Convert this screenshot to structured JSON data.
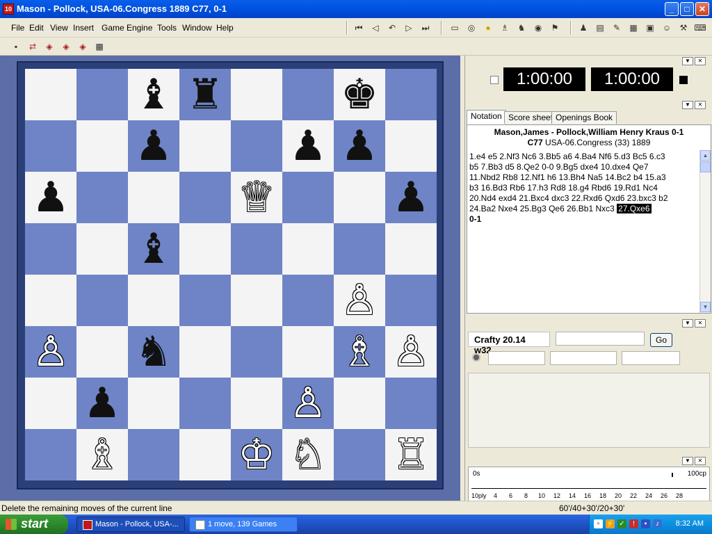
{
  "window": {
    "title": "Mason - Pollock, USA-06.Congress 1889  C77, 0-1",
    "app_icon_label": "10",
    "buttons": {
      "minimize": "_",
      "maximize": "□",
      "close": "✕"
    }
  },
  "menu": [
    "File",
    "Edit",
    "View",
    "Insert",
    "Game",
    "Engine",
    "Tools",
    "Window",
    "Help"
  ],
  "toolbar": {
    "nav_icons": [
      "first-icon",
      "back-icon",
      "back-move-icon",
      "forward-icon",
      "last-icon"
    ],
    "tool_icons": [
      "open-icon",
      "globe-icon",
      "info-icon",
      "player-icon",
      "engine-icon",
      "world-icon",
      "flag-icon",
      "pin-icon",
      "book-icon",
      "pen-icon",
      "database-icon",
      "calculator-icon",
      "person-icon",
      "tools-icon",
      "keyboard-icon"
    ],
    "second_row_icons": [
      "save-icon",
      "swap-icon",
      "cube1-icon",
      "cube2-icon",
      "cube3-icon",
      "board-icon"
    ]
  },
  "board": {
    "ranks": [
      [
        "",
        "",
        "b:♝",
        "b:♜",
        "",
        "",
        "b:♚",
        ""
      ],
      [
        "",
        "",
        "b:♟",
        "",
        "",
        "b:♟",
        "b:♟",
        ""
      ],
      [
        "b:♟",
        "",
        "",
        "",
        "w:♕",
        "",
        "",
        "b:♟"
      ],
      [
        "",
        "",
        "b:♝",
        "",
        "",
        "",
        "",
        ""
      ],
      [
        "",
        "",
        "",
        "",
        "",
        "",
        "w:♙",
        ""
      ],
      [
        "w:♙",
        "",
        "b:♞",
        "",
        "",
        "",
        "w:♗",
        "w:♙"
      ],
      [
        "",
        "b:♟",
        "",
        "",
        "",
        "w:♙",
        "",
        ""
      ],
      [
        "",
        "w:♗",
        "",
        "",
        "w:♔",
        "w:♘",
        "",
        "w:♖"
      ]
    ]
  },
  "clocks": {
    "white": "1:00:00",
    "black": "1:00:00"
  },
  "tabs": [
    "Notation",
    "Score sheet",
    "Openings Book"
  ],
  "notation": {
    "header_players": "Mason,James - Pollock,William Henry Kraus   0-1",
    "header_eco": "C77",
    "header_event": "USA-06.Congress (33) 1889",
    "lines": [
      "1.e4  e5  2.Nf3  Nc6  3.Bb5  a6  4.Ba4  Nf6  5.d3  Bc5  6.c3",
      "b5  7.Bb3  d5  8.Qe2  0-0  9.Bg5  dxe4  10.dxe4  Qe7",
      "11.Nbd2  Rb8  12.Nf1  h6  13.Bh4  Na5  14.Bc2  b4  15.a3",
      "b3  16.Bd3  Rb6  17.h3  Rd8  18.g4  Rbd6  19.Rd1  Nc4",
      "20.Nd4  exd4  21.Bxc4  dxc3  22.Rxd6  Qxd6  23.bxc3  b2",
      "24.Ba2  Nxe4  25.Bg3  Qe6  26.Bb1  Nxc3  "
    ],
    "highlight_move": "27.Qxe6",
    "result": "0-1"
  },
  "engine": {
    "name": "Crafty 20.14 w32",
    "go_label": "Go"
  },
  "timeline": {
    "left_label": "0s",
    "right_label": "100cp",
    "ply_label": "10ply",
    "ticks": [
      "4",
      "6",
      "8",
      "10",
      "12",
      "14",
      "16",
      "18",
      "20",
      "22",
      "24",
      "26",
      "28"
    ]
  },
  "status": {
    "message": "Delete the remaining moves of the current line",
    "time_control": "60'/40+30'/20+30'"
  },
  "taskbar": {
    "start_label": "start",
    "tasks": [
      {
        "label": "Mason - Pollock, USA-...",
        "active": true
      },
      {
        "label": "1 move,  139 Games",
        "active": false
      }
    ],
    "clock": "8:32 AM"
  }
}
